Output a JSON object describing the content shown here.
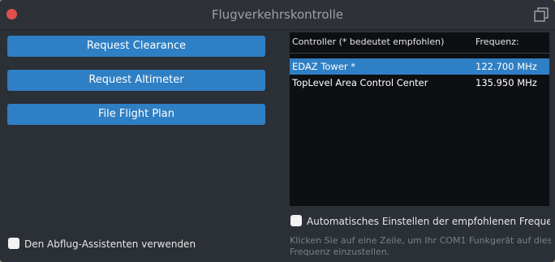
{
  "window": {
    "title": "Flugverkehrskontrolle",
    "close_icon": "close-icon",
    "popout_icon": "popout-window-icon"
  },
  "actions": {
    "request_clearance": "Request Clearance",
    "request_altimeter": "Request Altimeter",
    "file_flight_plan": "File Flight Plan"
  },
  "controllers": {
    "header_controller": "Controller (* bedeutet empfohlen)",
    "header_frequency": "Frequenz:",
    "rows": [
      {
        "name": "EDAZ Tower *",
        "frequency": "122.700 MHz",
        "selected": true
      },
      {
        "name": "TopLevel Area Control Center",
        "frequency": "135.950 MHz",
        "selected": false
      }
    ]
  },
  "options": {
    "auto_tune_label": "Automatisches Einstellen der empfohlenen Frequenz",
    "auto_tune_checked": false,
    "departure_assistant_label": "Den Abflug-Assistenten verwenden",
    "departure_assistant_checked": false
  },
  "hint": {
    "line1": "Klicken Sie auf eine Zeile, um Ihr COM1 Funkgerät auf diese",
    "line2": "Frequenz einzustellen."
  },
  "colors": {
    "accent": "#2f7fc4",
    "close": "#e0504e",
    "background": "#2b2f36",
    "list_background": "#0d0f12"
  }
}
